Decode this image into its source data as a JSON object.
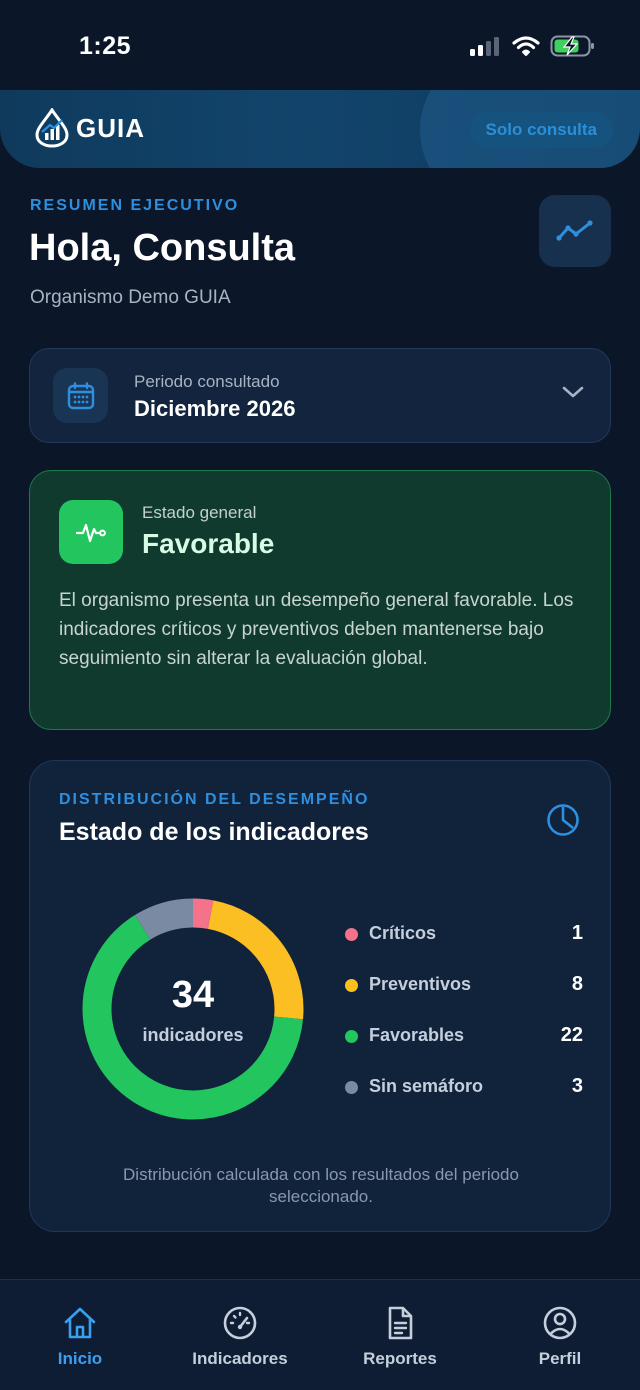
{
  "status_bar": {
    "time": "1:25"
  },
  "header": {
    "logo_text": "GUIA",
    "mode_badge": "Solo consulta"
  },
  "greeting": {
    "eyebrow": "RESUMEN EJECUTIVO",
    "title": "Hola, Consulta",
    "organization": "Organismo Demo GUIA"
  },
  "period": {
    "label": "Periodo consultado",
    "value": "Diciembre 2026"
  },
  "general_status": {
    "label": "Estado general",
    "value": "Favorable",
    "description": "El organismo presenta un desempeño general favorable. Los indicadores críticos y preventivos deben mantenerse bajo seguimiento sin alterar la evaluación global."
  },
  "distribution": {
    "eyebrow": "DISTRIBUCIÓN DEL DESEMPEÑO",
    "title": "Estado de los indicadores",
    "total": "34",
    "total_label": "indicadores",
    "note": "Distribución calculada con los resultados del periodo seleccionado.",
    "items": [
      {
        "name": "Críticos",
        "count": "1",
        "color": "#f4728a"
      },
      {
        "name": "Preventivos",
        "count": "8",
        "color": "#fbbf24"
      },
      {
        "name": "Favorables",
        "count": "22",
        "color": "#22c55e"
      },
      {
        "name": "Sin semáforo",
        "count": "3",
        "color": "#7a8aa3"
      }
    ]
  },
  "chart_data": {
    "type": "pie",
    "categories": [
      "Críticos",
      "Preventivos",
      "Favorables",
      "Sin semáforo"
    ],
    "values": [
      1,
      8,
      22,
      3
    ],
    "colors": [
      "#f4728a",
      "#fbbf24",
      "#22c55e",
      "#7a8aa3"
    ],
    "title": "Estado de los indicadores"
  },
  "bottom_nav": [
    {
      "label": "Inicio",
      "icon": "home-icon",
      "active": true
    },
    {
      "label": "Indicadores",
      "icon": "gauge-icon",
      "active": false
    },
    {
      "label": "Reportes",
      "icon": "document-icon",
      "active": false
    },
    {
      "label": "Perfil",
      "icon": "user-icon",
      "active": false
    }
  ]
}
